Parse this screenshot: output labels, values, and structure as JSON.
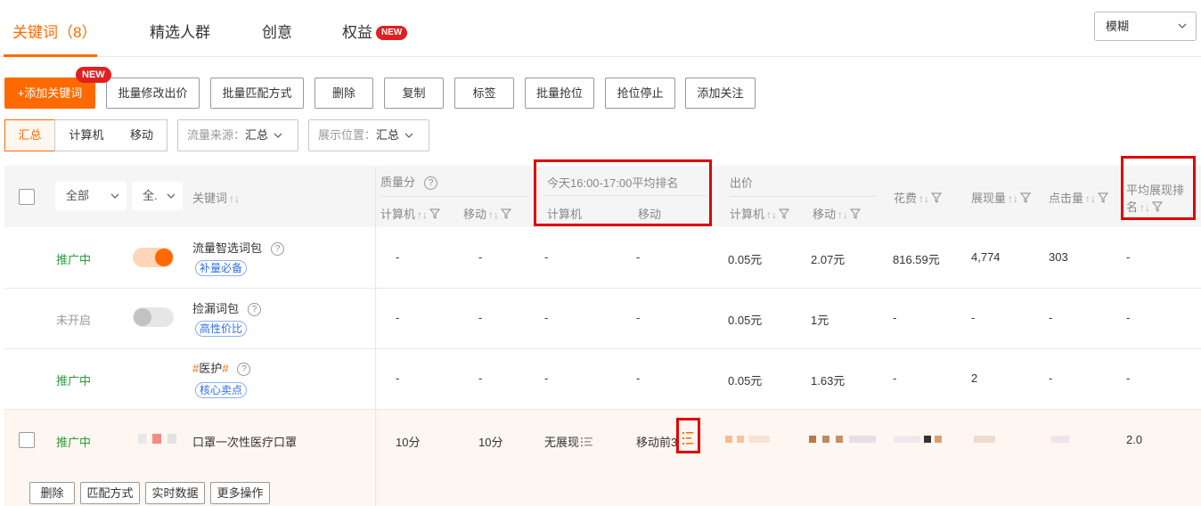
{
  "tabs": [
    {
      "label": "关键词（8）"
    },
    {
      "label": "精选人群"
    },
    {
      "label": "创意"
    },
    {
      "label": "权益",
      "badge": "NEW"
    }
  ],
  "match_mode": {
    "value": "模糊"
  },
  "toolbar": {
    "add_badge": "NEW",
    "buttons": [
      "+添加关键词",
      "批量修改出价",
      "批量匹配方式",
      "删除",
      "复制",
      "标签",
      "批量抢位",
      "抢位停止",
      "添加关注"
    ]
  },
  "filters": {
    "device_segments": [
      "汇总",
      "计算机",
      "移动"
    ],
    "traffic_source": {
      "label": "流量来源：",
      "value": "汇总"
    },
    "display_position": {
      "label": "展示位置：",
      "value": "汇总"
    }
  },
  "table": {
    "header": {
      "status_filter": "全部",
      "switch_filter": "全.",
      "keyword": "关键词",
      "quality": "质量分",
      "quality_pc": "计算机",
      "quality_mobile": "移动",
      "rank_group": "今天16:00-17:00平均排名",
      "rank_pc": "计算机",
      "rank_mobile": "移动",
      "bid": "出价",
      "bid_pc": "计算机",
      "bid_mobile": "移动",
      "cost": "花费",
      "impressions": "展现量",
      "clicks": "点击量",
      "avg_rank_line1": "平均展现排",
      "avg_rank_line2": "名",
      "sort_glyph": "↑↓"
    },
    "rows": [
      {
        "status": "推广中",
        "on": true,
        "keyword": "流量智选词包",
        "tag": "补量必备",
        "q_pc": "-",
        "q_mobile": "-",
        "r_pc": "-",
        "r_mobile": "-",
        "bid_pc": "0.05元",
        "bid_mobile": "2.07元",
        "cost": "816.59元",
        "impressions": "4,774",
        "clicks": "303",
        "avg_rank": "-"
      },
      {
        "status": "未开启",
        "on": false,
        "keyword": "捡漏词包",
        "tag": "高性价比",
        "q_pc": "-",
        "q_mobile": "-",
        "r_pc": "-",
        "r_mobile": "-",
        "bid_pc": "0.05元",
        "bid_mobile": "1元",
        "cost": "-",
        "impressions": "-",
        "clicks": "-",
        "avg_rank": "-"
      },
      {
        "status": "推广中",
        "keyword_hash": "#",
        "keyword_core": "医护",
        "tag": "核心卖点",
        "q_pc": "-",
        "q_mobile": "-",
        "r_pc": "-",
        "r_mobile": "-",
        "bid_pc": "0.05元",
        "bid_mobile": "1.63元",
        "cost": "-",
        "impressions": "2",
        "clicks": "-",
        "avg_rank": "-"
      },
      {
        "status": "推广中",
        "keyword": "口罩一次性医疗口罩",
        "q_pc": "10分",
        "q_mobile": "10分",
        "r_pc": "无展现",
        "r_mobile": "移动前3",
        "avg_rank": "2.0"
      }
    ],
    "row_actions": [
      "删除",
      "匹配方式",
      "实时数据",
      "更多操作"
    ]
  }
}
